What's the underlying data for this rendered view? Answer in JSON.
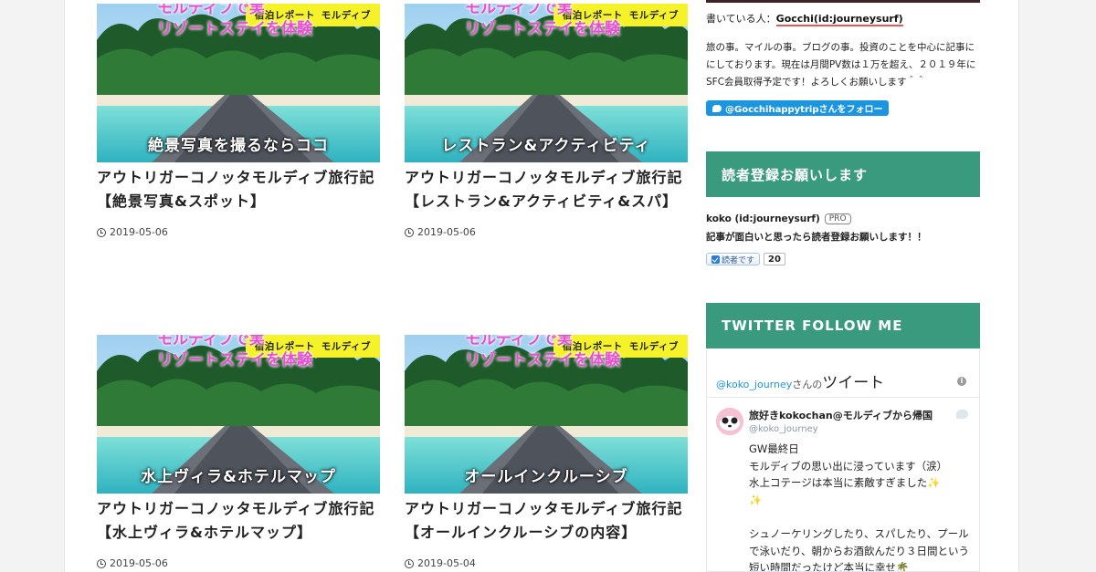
{
  "posts": [
    {
      "cats": [
        "宿泊レポート",
        "モルディブ"
      ],
      "thumb_top_line1": "モルディブで実",
      "thumb_top_line2": "リゾートステイを体験",
      "thumb_caption": "絶景写真を撮るならココ",
      "title_line1": "アウトリガーコノッタモルディブ旅行記",
      "title_line2": "【絶景写真&スポット】",
      "date": "2019-05-06"
    },
    {
      "cats": [
        "宿泊レポート",
        "モルディブ"
      ],
      "thumb_top_line1": "モルディブで実",
      "thumb_top_line2": "リゾートステイを体験",
      "thumb_caption": "レストラン&アクティビティ",
      "title_line1": "アウトリガーコノッタモルディブ旅行記",
      "title_line2": "【レストラン&アクティビティ&スパ】",
      "date": "2019-05-06"
    },
    {
      "cats": [
        "宿泊レポート",
        "モルディブ"
      ],
      "thumb_top_line1": "モルディブで実",
      "thumb_top_line2": "リゾートステイを体験",
      "thumb_caption": "水上ヴィラ&ホテルマップ",
      "title_line1": "アウトリガーコノッタモルディブ旅行記",
      "title_line2": "【水上ヴィラ&ホテルマップ】",
      "date": "2019-05-06"
    },
    {
      "cats": [
        "宿泊レポート",
        "モルディブ"
      ],
      "thumb_top_line1": "モルディブで実",
      "thumb_top_line2": "リゾートステイを体験",
      "thumb_caption": "オールインクルーシブ",
      "title_line1": "アウトリガーコノッタモルディブ旅行記",
      "title_line2": "【オールインクルーシブの内容】",
      "date": "2019-05-04"
    }
  ],
  "sidebar": {
    "author_prefix": "書いている人：",
    "author_link": "Gocchi(id:journeysurf)",
    "bio": "旅の事。マイルの事。ブログの事。投資のことを中心に記事ににしております。現在は月間PV数は１万を超え、２０１９年にSFC会員取得予定です！よろしくお願いします＾＾",
    "follow_button": "@Gocchihappytripさんをフォロー",
    "reader_heading": "読者登録お願いします",
    "reader_name": "koko (id:journeysurf)",
    "pro_badge": "PRO",
    "reader_desc": "記事が面白いと思ったら読者登録お願いします！！",
    "subscribe_label": "読者です",
    "subscribe_count": "20",
    "twitter_heading": "TWITTER FOLLOW ME",
    "twitter": {
      "head_handle": "@koko_journey",
      "head_suffix": "さんの",
      "head_title": "ツイート",
      "name": "旅好きkokochan@モルディブから帰国",
      "handle": "@koko_journey",
      "text": "GW最終日\nモルディブの思い出に浸っています（涙）\n水上コテージは本当に素敵すぎました✨\n✨\n\nシュノーケリングしたり、スパしたり、プールで泳いだり、朝からお酒飲んだり３日間という短い時間だったけど本当に幸せ🌴"
    }
  },
  "colors": {
    "accent": "#3a9a7d",
    "topbar": "#3b2327",
    "thumb_tag": "#f6f22a",
    "thumb_headline": "#e84fd0",
    "twitter_blue": "#1b95e0"
  }
}
